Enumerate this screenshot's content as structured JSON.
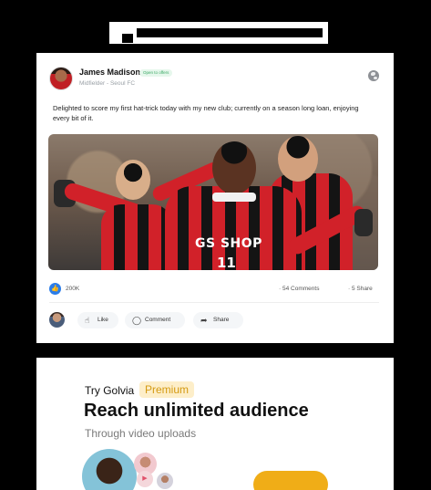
{
  "post": {
    "author_name": "James Madison",
    "badge": "Open to offers",
    "author_role": "Midfielder - Seoul FC",
    "text": "Delighted to score my first hat-trick today with my new club; currently on a season long loan, enjoying every bit of it.",
    "photo": {
      "shirt_sponsor": "GS SHOP",
      "shirt_number": "11"
    },
    "reactions_count": "200K",
    "comments_count": "54 Comments",
    "shares_count": "5 Share",
    "actions": {
      "like": "Like",
      "comment": "Comment",
      "share": "Share"
    }
  },
  "promo": {
    "try_label": "Try Golvia",
    "premium_label": "Premium",
    "headline": "Reach unlimited audience",
    "subtitle": "Through video uploads"
  },
  "icons": {
    "visibility": "globe-icon",
    "reaction": "thumbs-up-icon",
    "like": "thumbs-up-outline-icon",
    "comment": "speech-bubble-icon",
    "share": "share-arrow-icon",
    "play": "play-icon"
  },
  "colors": {
    "accent_blue": "#2b7de9",
    "premium_gold": "#f0ad17",
    "badge_green": "#3aa864"
  }
}
